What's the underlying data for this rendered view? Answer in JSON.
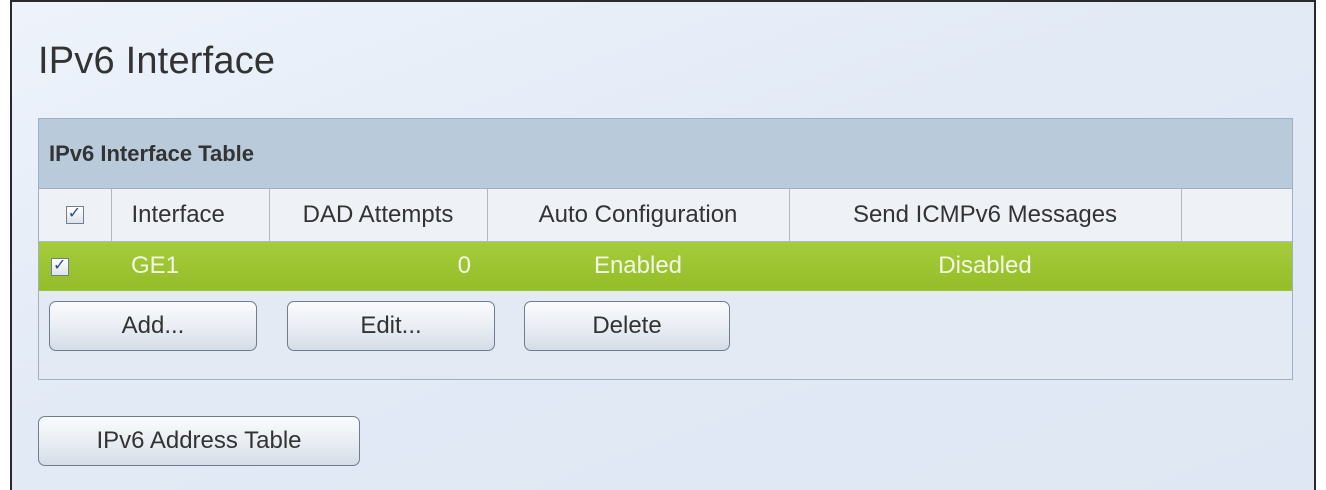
{
  "page": {
    "title": "IPv6 Interface"
  },
  "interface_table": {
    "caption": "IPv6 Interface Table",
    "select_all_checked": true,
    "columns": [
      "Interface",
      "DAD Attempts",
      "Auto Configuration",
      "Send ICMPv6 Messages"
    ],
    "rows": [
      {
        "checked": true,
        "selected": true,
        "interface": "GE1",
        "dad_attempts": "0",
        "auto_configuration": "Enabled",
        "send_icmpv6_messages": "Disabled"
      }
    ],
    "selected_row_color": "#9ec532",
    "buttons": {
      "add": "Add...",
      "edit": "Edit...",
      "delete": "Delete"
    }
  },
  "address_table_button": "IPv6 Address Table",
  "icons": {
    "checkbox_checked": "checkbox-checked-icon"
  }
}
